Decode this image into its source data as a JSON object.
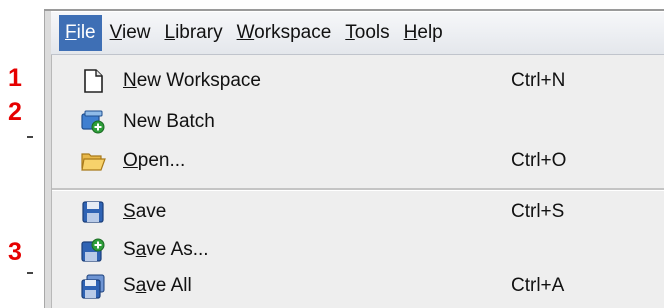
{
  "menubar": {
    "items": [
      {
        "pre": "",
        "mn": "F",
        "post": "ile"
      },
      {
        "pre": "",
        "mn": "V",
        "post": "iew"
      },
      {
        "pre": "",
        "mn": "L",
        "post": "ibrary"
      },
      {
        "pre": "",
        "mn": "W",
        "post": "orkspace"
      },
      {
        "pre": "",
        "mn": "T",
        "post": "ools"
      },
      {
        "pre": "",
        "mn": "H",
        "post": "elp"
      }
    ],
    "active_index": 0
  },
  "markers": [
    "1",
    "2",
    "3"
  ],
  "file_menu": {
    "items": [
      {
        "icon": "new-document-icon",
        "pre": "",
        "mn": "N",
        "post": "ew Workspace",
        "shortcut": "Ctrl+N"
      },
      {
        "icon": "new-batch-icon",
        "pre": "New Batch",
        "mn": "",
        "post": "",
        "shortcut": ""
      },
      {
        "icon": "folder-open-icon",
        "pre": "",
        "mn": "O",
        "post": "pen...",
        "shortcut": "Ctrl+O"
      },
      {
        "icon": "save-icon",
        "pre": "",
        "mn": "S",
        "post": "ave",
        "shortcut": "Ctrl+S"
      },
      {
        "icon": "save-as-icon",
        "pre": "S",
        "mn": "a",
        "post": "ve As...",
        "shortcut": ""
      },
      {
        "icon": "save-all-icon",
        "pre": "S",
        "mn": "a",
        "post": "ve All",
        "shortcut": "Ctrl+A"
      }
    ]
  },
  "colors": {
    "active_menu_bg": "#3e6fb5",
    "menu_bg": "#eeeeee",
    "marker": "#e60000"
  }
}
